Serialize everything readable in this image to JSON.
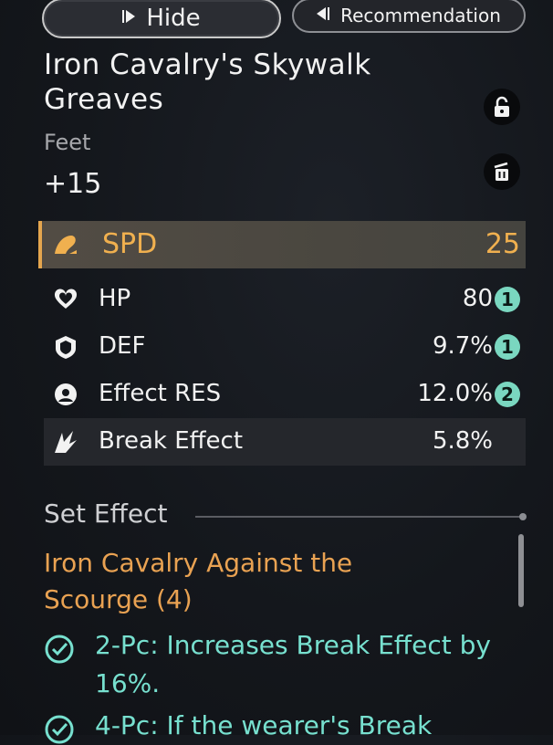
{
  "buttons": {
    "hide_label": "Hide",
    "recommendation_label": "Recommendation"
  },
  "relic": {
    "name": "Iron Cavalry's Skywalk Greaves",
    "slot": "Feet",
    "level": "+15"
  },
  "main_stat": {
    "name": "SPD",
    "value": "25"
  },
  "sub_stats": [
    {
      "name": "HP",
      "value": "80",
      "rolls": "1",
      "icon": "heart-icon"
    },
    {
      "name": "DEF",
      "value": "9.7%",
      "rolls": "1",
      "icon": "shield-icon"
    },
    {
      "name": "Effect RES",
      "value": "12.0%",
      "rolls": "2",
      "icon": "effect-res-icon"
    },
    {
      "name": "Break Effect",
      "value": "5.8%",
      "rolls": "",
      "icon": "break-effect-icon"
    }
  ],
  "set_effect": {
    "header": "Set Effect",
    "name": "Iron Cavalry Against the Scourge (4)",
    "effects": [
      {
        "text": "2-Pc: Increases Break Effect by 16%."
      },
      {
        "text": "4-Pc: If the wearer's Break"
      }
    ]
  },
  "colors": {
    "accent_gold": "#f0b04f",
    "set_name": "#e9a252",
    "effect_text": "#77e0cf",
    "roll_badge": "#7ad7c0"
  }
}
